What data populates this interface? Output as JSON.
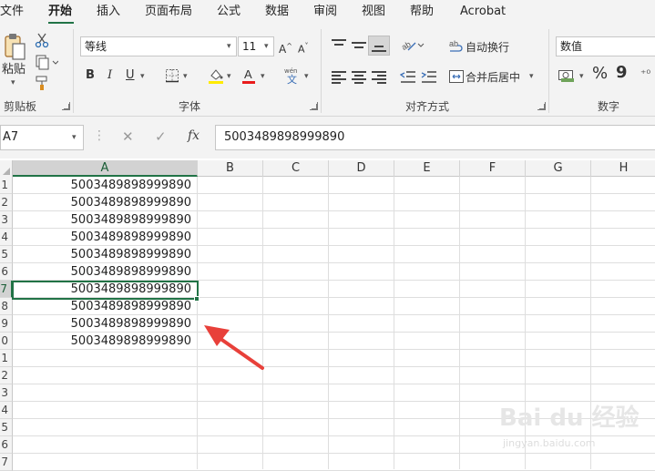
{
  "menu": {
    "tabs": [
      "文件",
      "开始",
      "插入",
      "页面布局",
      "公式",
      "数据",
      "审阅",
      "视图",
      "帮助",
      "Acrobat"
    ],
    "active": "开始"
  },
  "ribbon": {
    "clipboard": {
      "label": "剪贴板",
      "paste": "粘贴"
    },
    "font": {
      "label": "字体",
      "family": "等线",
      "size": "11",
      "grow": "A^",
      "shrink": "A˅",
      "bold": "B",
      "italic": "I",
      "underline": "U",
      "phonetic": "wén\n文"
    },
    "align": {
      "label": "对齐方式",
      "wrap": "自动换行",
      "merge": "合并后居中"
    },
    "number": {
      "label": "数字",
      "format": "数值",
      "percent": "%",
      "comma": "9"
    }
  },
  "formula_bar": {
    "name_box": "A7",
    "fx": "fx",
    "value": "5003489898999890"
  },
  "grid": {
    "columns": [
      "A",
      "B",
      "C",
      "D",
      "E",
      "F",
      "G",
      "H"
    ],
    "rows": [
      "1",
      "2",
      "3",
      "4",
      "5",
      "6",
      "7",
      "8",
      "9",
      "0",
      "1",
      "2",
      "3",
      "4",
      "5",
      "6",
      "7"
    ],
    "selected_column": "A",
    "selected_row_index": 6,
    "column_a_values": [
      "5003489898999890",
      "5003489898999890",
      "5003489898999890",
      "5003489898999890",
      "5003489898999890",
      "5003489898999890",
      "5003489898999890",
      "5003489898999890",
      "5003489898999890",
      "5003489898999890"
    ],
    "arrow_color": "#e8403a",
    "accent": "#217346"
  },
  "watermark": {
    "main": "Bai du 经验",
    "sub": "jingyan.baidu.com"
  }
}
